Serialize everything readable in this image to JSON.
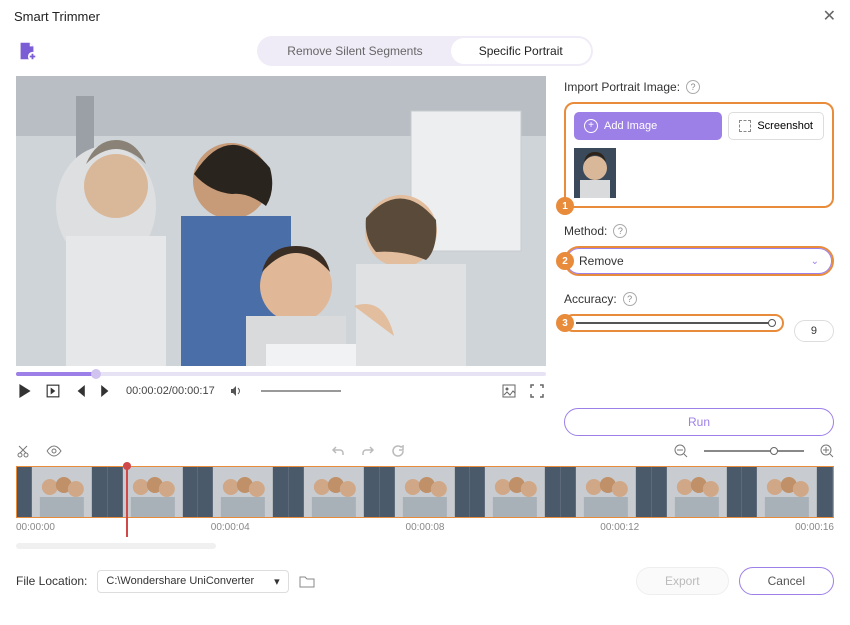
{
  "window": {
    "title": "Smart Trimmer"
  },
  "tabs": {
    "silent": "Remove Silent Segments",
    "portrait": "Specific Portrait"
  },
  "player": {
    "time": "00:00:02/00:00:17"
  },
  "panel": {
    "import_label": "Import Portrait Image:",
    "add_image": "Add Image",
    "screenshot": "Screenshot",
    "method_label": "Method:",
    "method_value": "Remove",
    "accuracy_label": "Accuracy:",
    "accuracy_value": "9",
    "run": "Run"
  },
  "callouts": {
    "n1": "1",
    "n2": "2",
    "n3": "3"
  },
  "timeline": {
    "ticks": [
      "00:00:00",
      "00:00:04",
      "00:00:08",
      "00:00:12",
      "00:00:16"
    ]
  },
  "footer": {
    "location_label": "File Location:",
    "location_value": "C:\\Wondershare UniConverter",
    "export": "Export",
    "cancel": "Cancel"
  }
}
